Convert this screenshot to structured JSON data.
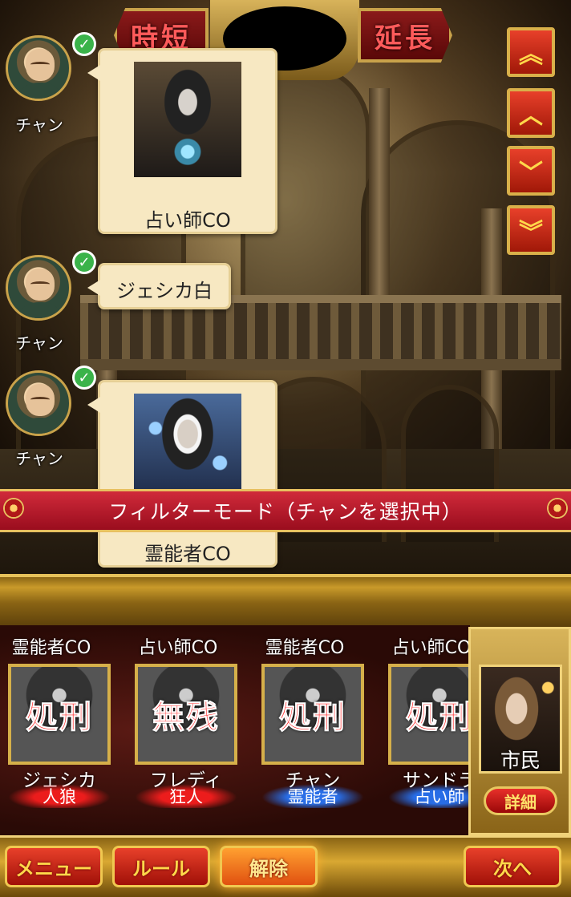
{
  "top_bar": {
    "shorten_label": "時短",
    "extend_label": "延長"
  },
  "scroll_buttons": [
    {
      "icon": "double-chevron-up-icon",
      "glyph": "︽"
    },
    {
      "icon": "chevron-up-icon",
      "glyph": "︿"
    },
    {
      "icon": "chevron-down-icon",
      "glyph": "﹀"
    },
    {
      "icon": "double-chevron-down-icon",
      "glyph": "︾"
    }
  ],
  "chat": [
    {
      "speaker": "チャン",
      "type": "card",
      "text": "占い師CO"
    },
    {
      "speaker": "チャン",
      "type": "text",
      "text": "ジェシカ白"
    },
    {
      "speaker": "チャン",
      "type": "card",
      "text": "霊能者CO"
    }
  ],
  "check_glyph": "✓",
  "filter_banner": "フィルターモード（チャンを選択中）",
  "players": [
    {
      "co": "霊能者CO",
      "stamp": "処刑",
      "name": "ジェシカ",
      "role": "人狼",
      "role_color": "red"
    },
    {
      "co": "占い師CO",
      "stamp": "無残",
      "name": "フレディ",
      "role": "狂人",
      "role_color": "red"
    },
    {
      "co": "霊能者CO",
      "stamp": "処刑",
      "name": "チャン",
      "role": "霊能者",
      "role_color": "blue"
    },
    {
      "co": "占い師CO",
      "stamp": "処刑",
      "name": "サンドラ",
      "role": "占い師",
      "role_color": "blue"
    }
  ],
  "own_card": {
    "role": "市民",
    "detail_label": "詳細"
  },
  "bottom_nav": {
    "menu_label": "メニュー",
    "rules_label": "ルール",
    "release_label": "解除",
    "next_label": "次へ"
  }
}
